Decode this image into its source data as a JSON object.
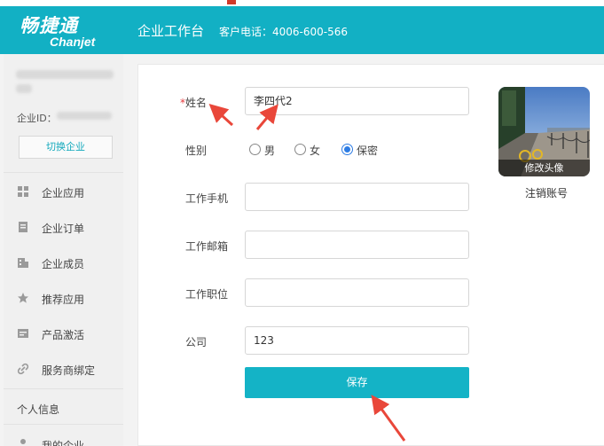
{
  "header": {
    "logo_cn": "畅捷通",
    "logo_en": "Chanjet",
    "title": "企业工作台",
    "phone": "客户电话：4006-600-566"
  },
  "sidebar": {
    "enterprise_id_label": "企业ID：",
    "switch_button": "切换企业",
    "items": [
      {
        "label": "企业应用",
        "icon": "apps-icon"
      },
      {
        "label": "企业订单",
        "icon": "order-icon"
      },
      {
        "label": "企业成员",
        "icon": "members-icon"
      },
      {
        "label": "推荐应用",
        "icon": "star-icon"
      },
      {
        "label": "产品激活",
        "icon": "activate-icon"
      },
      {
        "label": "服务商绑定",
        "icon": "link-icon"
      }
    ],
    "section_personal": "个人信息",
    "my_enterprise": "我的企业"
  },
  "form": {
    "required_mark": "*",
    "name_label": "姓名",
    "name_value": "李四代2",
    "gender_label": "性别",
    "gender_options": [
      "男",
      "女",
      "保密"
    ],
    "gender_selected": "保密",
    "phone_label": "工作手机",
    "phone_value": "",
    "email_label": "工作邮箱",
    "email_value": "",
    "position_label": "工作职位",
    "position_value": "",
    "company_label": "公司",
    "company_value": "123",
    "save_button": "保存"
  },
  "profile": {
    "avatar_caption": "修改头像",
    "cancel_account": "注销账号"
  },
  "colors": {
    "header": "#12b0c4",
    "save_button": "#14b3c6",
    "annotation_arrow": "#e9473a",
    "required": "#e4393c"
  }
}
